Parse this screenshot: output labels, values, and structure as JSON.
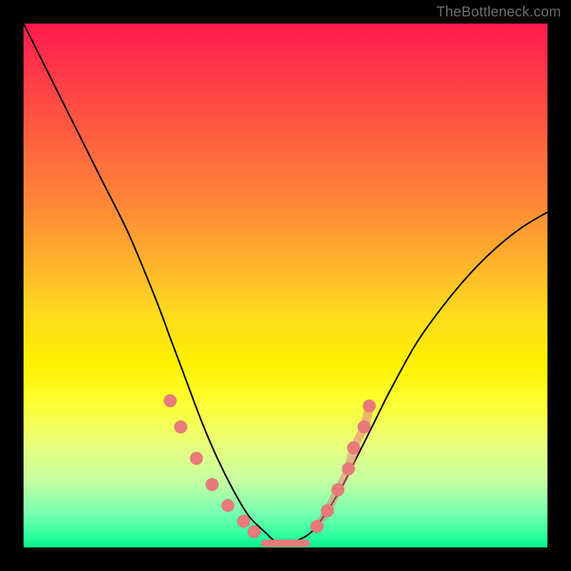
{
  "watermark": "TheBottleneck.com",
  "colors": {
    "frame": "#000000",
    "curve": "#000000",
    "marker": "#e97a7a",
    "gradient_top": "#ff1a4d",
    "gradient_mid": "#fff200",
    "gradient_bottom": "#00f08a"
  },
  "chart_data": {
    "type": "line",
    "title": "",
    "xlabel": "",
    "ylabel": "",
    "xlim": [
      0,
      100
    ],
    "ylim": [
      0,
      100
    ],
    "grid": false,
    "legend": false,
    "series": [
      {
        "name": "bottleneck-curve",
        "x": [
          0,
          5,
          10,
          15,
          20,
          25,
          28,
          31,
          34,
          37,
          40,
          43,
          46,
          48,
          50,
          52,
          55,
          58,
          61,
          64,
          67,
          70,
          75,
          80,
          85,
          90,
          95,
          100
        ],
        "y": [
          100,
          90,
          80,
          70,
          60,
          48,
          40,
          32,
          24,
          17,
          11,
          6,
          3,
          1.2,
          0.6,
          1.2,
          3,
          7,
          12,
          18,
          24,
          30,
          39,
          46,
          52,
          57,
          61,
          64
        ]
      }
    ],
    "markers_left": [
      {
        "x": 28,
        "y": 28
      },
      {
        "x": 30,
        "y": 23
      },
      {
        "x": 33,
        "y": 17
      },
      {
        "x": 36,
        "y": 12
      },
      {
        "x": 39,
        "y": 8
      },
      {
        "x": 42,
        "y": 5
      },
      {
        "x": 44,
        "y": 3
      }
    ],
    "markers_right": [
      {
        "x": 56,
        "y": 4
      },
      {
        "x": 58,
        "y": 7
      },
      {
        "x": 60,
        "y": 11
      },
      {
        "x": 62,
        "y": 15
      },
      {
        "x": 63,
        "y": 19
      },
      {
        "x": 65,
        "y": 23
      },
      {
        "x": 66,
        "y": 27
      }
    ],
    "flat_segment": {
      "x0": 46,
      "x1": 54,
      "y": 0.8
    }
  }
}
